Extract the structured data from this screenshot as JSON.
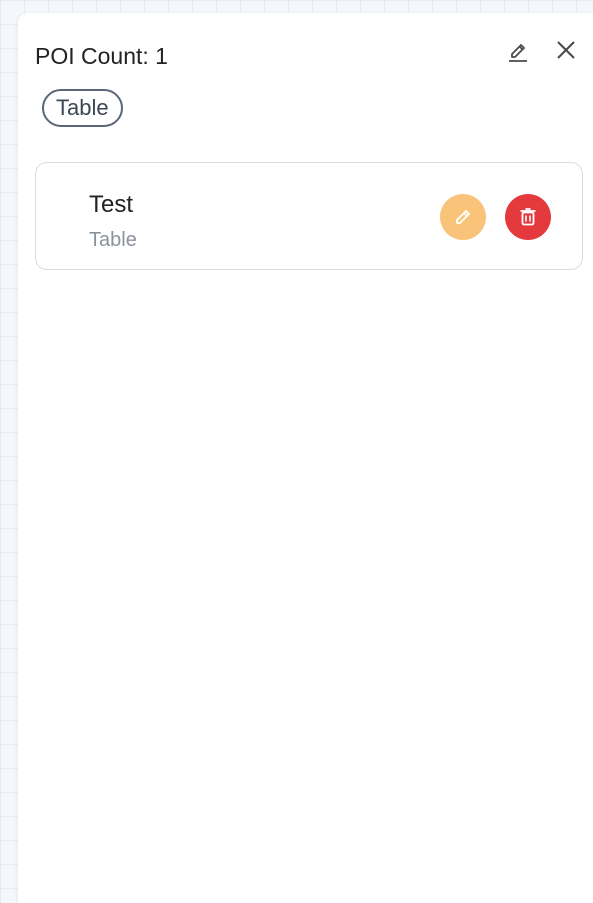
{
  "header": {
    "title": "POI Count: 1",
    "edit_icon": "pencil-underline-icon",
    "close_icon": "close-icon"
  },
  "filter_chip": {
    "label": "Table"
  },
  "poi_list": [
    {
      "name": "Test",
      "type": "Table",
      "edit_icon": "pencil-icon",
      "delete_icon": "trash-icon"
    }
  ],
  "colors": {
    "edit_button": "#f9c47a",
    "delete_button": "#e33a3e",
    "chip_border": "#5b6778",
    "subtitle": "#8a929c"
  }
}
